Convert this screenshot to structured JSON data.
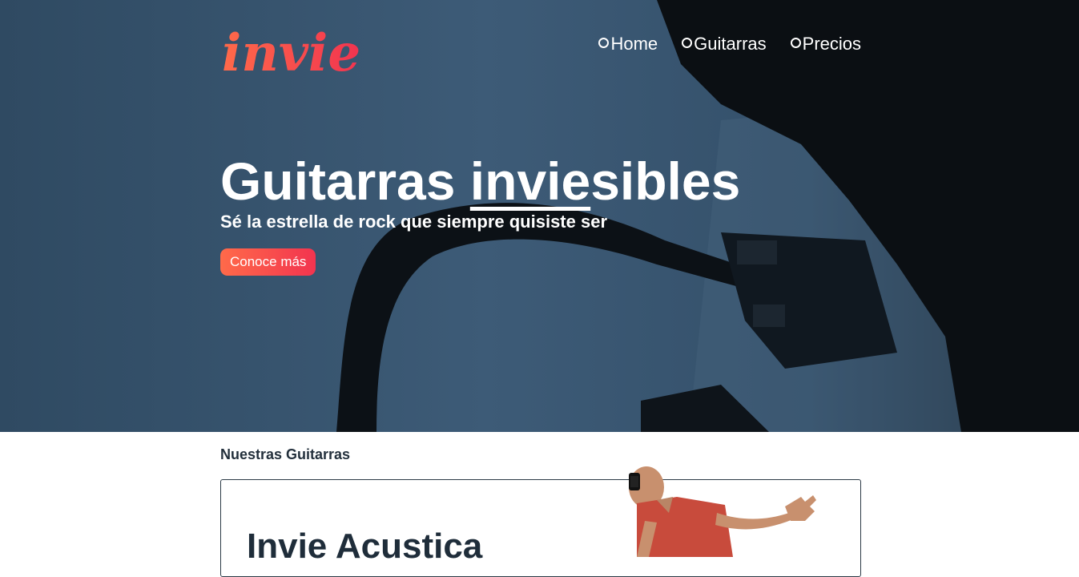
{
  "brand": {
    "logo_text": "invie",
    "logo_gradient": [
      "#ff6a4a",
      "#f2344f"
    ]
  },
  "nav": {
    "items": [
      {
        "label": "Home"
      },
      {
        "label": "Guitarras"
      },
      {
        "label": "Precios"
      }
    ]
  },
  "hero": {
    "title_before": "Guitarras ",
    "title_underlined": "invie",
    "title_after": "sibles",
    "subtitle": "Sé la estrella de rock que siempre quisiste ser",
    "cta_label": "Conoce más",
    "background_color": "#3b5872"
  },
  "guitars_section": {
    "title": "Nuestras Guitarras",
    "card": {
      "title": "Invie Acustica"
    }
  }
}
